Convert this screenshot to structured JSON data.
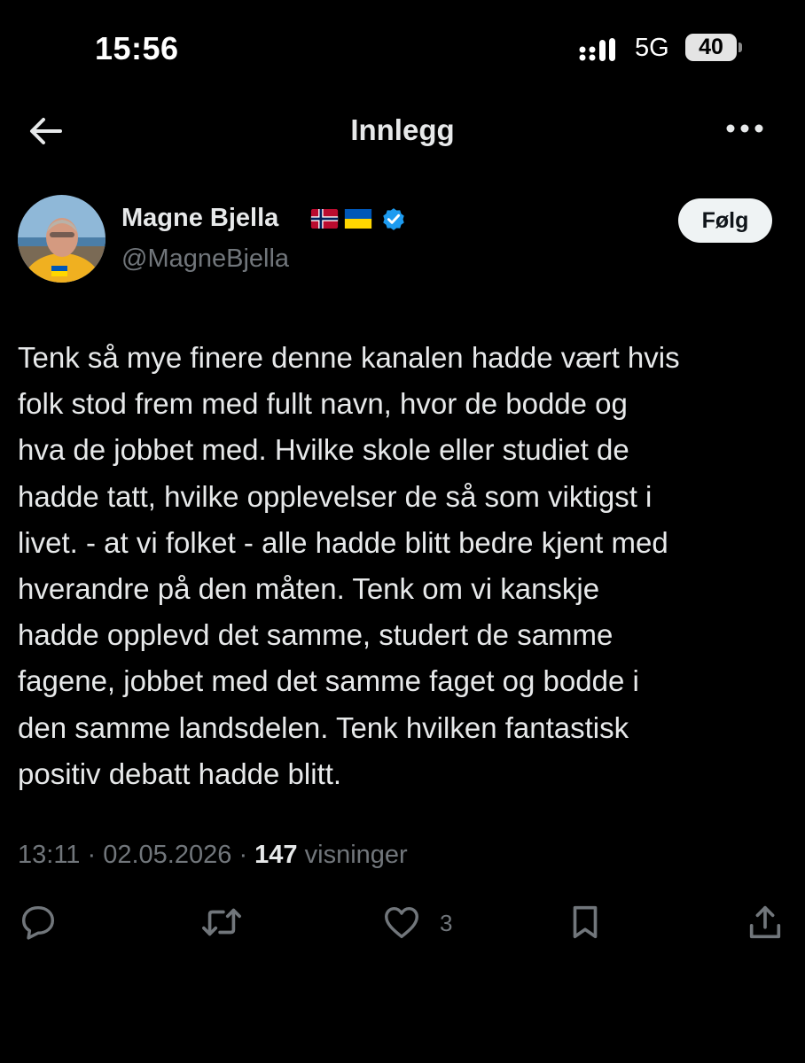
{
  "status_bar": {
    "time": "15:56",
    "network": "5G",
    "battery": "40",
    "icons": [
      "signal-icon",
      "battery-icon"
    ]
  },
  "header": {
    "title": "Innlegg",
    "back_icon": "arrow-left-icon",
    "more_icon": "more-dots-icon"
  },
  "author": {
    "name": "Magne Bjella",
    "flags": [
      "norway-flag-icon",
      "ukraine-flag-icon"
    ],
    "verified_icon": "verified-badge-icon",
    "handle": "@MagneBjella",
    "follow_label": "Følg"
  },
  "post": {
    "text": "Tenk så mye finere denne kanalen hadde vært hvis\nfolk stod frem med fullt navn, hvor de bodde og\nhva de jobbet med. Hvilke skole eller studiet de\nhadde tatt, hvilke opplevelser de så som viktigst i\nlivet. - at vi folket - alle hadde blitt bedre kjent med\nhverandre på den måten. Tenk om vi kanskje\nhadde opplevd det samme, studert de samme\nfagene, jobbet med det samme faget og bodde i\nden samme landsdelen. Tenk hvilken fantastisk\npositiv debatt hadde blitt.",
    "time": "13:11",
    "date": "02.05.2026",
    "separator": "·",
    "views_count": "147",
    "views_label": "visninger"
  },
  "actions": {
    "reply_icon": "reply-icon",
    "repost_icon": "repost-icon",
    "like_icon": "heart-icon",
    "like_count": "3",
    "bookmark_icon": "bookmark-icon",
    "share_icon": "share-icon"
  },
  "colors": {
    "background": "#000000",
    "text": "#e7e9ea",
    "secondary": "#71767b",
    "verified": "#1d9bf0",
    "follow_bg": "#eff3f4"
  }
}
